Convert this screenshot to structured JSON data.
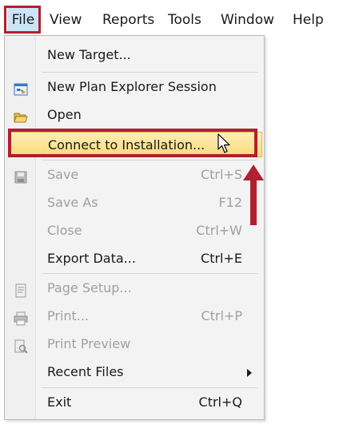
{
  "menubar": {
    "items": [
      {
        "label": "File"
      },
      {
        "label": "View"
      },
      {
        "label": "Reports"
      },
      {
        "label": "Tools"
      },
      {
        "label": "Window"
      },
      {
        "label": "Help"
      }
    ]
  },
  "file_menu": {
    "items": [
      {
        "label": "New Target...",
        "shortcut": ""
      },
      {
        "label": "New Plan Explorer Session",
        "shortcut": ""
      },
      {
        "label": "Open",
        "shortcut": ""
      },
      {
        "label": "Connect to Installation...",
        "shortcut": ""
      },
      {
        "label": "Save",
        "shortcut": "Ctrl+S"
      },
      {
        "label": "Save As",
        "shortcut": "F12"
      },
      {
        "label": "Close",
        "shortcut": "Ctrl+W"
      },
      {
        "label": "Export Data...",
        "shortcut": "Ctrl+E"
      },
      {
        "label": "Page Setup...",
        "shortcut": ""
      },
      {
        "label": "Print...",
        "shortcut": "Ctrl+P"
      },
      {
        "label": "Print Preview",
        "shortcut": ""
      },
      {
        "label": "Recent Files",
        "shortcut": ""
      },
      {
        "label": "Exit",
        "shortcut": "Ctrl+Q"
      }
    ]
  },
  "colors": {
    "highlight_box": "#b0202e",
    "hover_fill": "#fbd97a",
    "disabled_text": "#a0a0a0"
  }
}
